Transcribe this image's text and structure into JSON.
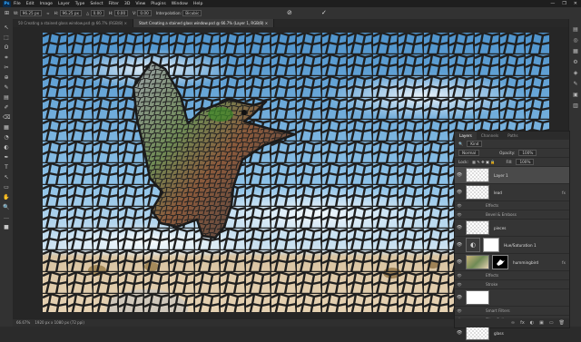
{
  "app": {
    "logo": "Ps"
  },
  "menu": [
    "File",
    "Edit",
    "Image",
    "Layer",
    "Type",
    "Select",
    "Filter",
    "3D",
    "View",
    "Plugins",
    "Window",
    "Help"
  ],
  "window_controls": [
    "—",
    "❐",
    "✕"
  ],
  "options": {
    "w_value": "96.25 px",
    "h_value": "96.25 px",
    "angle": "0.00",
    "x_value": "0.00",
    "y_value": "0.00",
    "interp": "Bicubic",
    "cancel": "⊘",
    "commit": "✓"
  },
  "tabs": [
    {
      "label": "50 Creating a stained glass window.psd @ 66.7% (RGB/8) ×",
      "active": false
    },
    {
      "label": "Start Creating a stained glass window.psd @ 66.7% (Layer 1, RGB/8) ×",
      "active": true
    }
  ],
  "status": {
    "zoom": "66.67%",
    "doc": "1920 px x 1080 px (72 ppi)"
  },
  "layers_panel": {
    "tabs": [
      "Layers",
      "Channels",
      "Paths"
    ],
    "kind_label": "Kind",
    "blend_mode": "Normal",
    "opacity_label": "Opacity:",
    "opacity": "100%",
    "lock_label": "Lock:",
    "fill_label": "Fill:",
    "fill": "100%",
    "layers": [
      {
        "name": "Layer 1",
        "selected": true,
        "thumb": "checker",
        "mask": "",
        "fx": ""
      },
      {
        "name": "lead",
        "selected": false,
        "thumb": "checker",
        "mask": "",
        "fx": "fx"
      },
      {
        "sub": "Effects"
      },
      {
        "sub": "Bevel & Emboss"
      },
      {
        "name": "pieces",
        "selected": false,
        "thumb": "checker",
        "mask": "",
        "fx": ""
      },
      {
        "name": "Hue/Saturation 1",
        "selected": false,
        "thumb": "adjust",
        "mask": "white",
        "fx": ""
      },
      {
        "name": "hummingbird",
        "selected": false,
        "thumb": "photo",
        "mask": "black",
        "fx": "fx"
      },
      {
        "sub": "Effects"
      },
      {
        "sub": "Stroke"
      },
      {
        "name": "",
        "selected": false,
        "thumb": "white",
        "mask": "",
        "fx": ""
      },
      {
        "sub": "Smart Filters"
      },
      {
        "sub": "Filter Gallery"
      },
      {
        "name": "glass",
        "selected": false,
        "thumb": "checker",
        "mask": "",
        "fx": ""
      }
    ],
    "footer_icons": [
      "∞",
      "fx",
      "◐",
      "▣",
      "▭",
      "🗑"
    ]
  },
  "tools": [
    "↖",
    "⬚",
    "ʘ",
    "⌗",
    "✂",
    "⊕",
    "✎",
    "▤",
    "✐",
    "⌫",
    "▦",
    "◔",
    "◐",
    "✒",
    "T",
    "↖",
    "▭",
    "✋",
    "🔍",
    "…",
    "■"
  ],
  "right_icons": [
    "▤",
    "◎",
    "▦",
    "⚙",
    "◈",
    "✎",
    "▣",
    "▥"
  ]
}
